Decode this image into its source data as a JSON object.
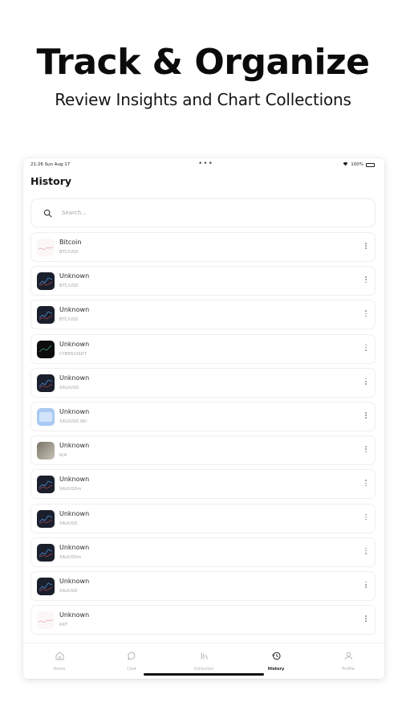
{
  "hero": {
    "title": "Track & Organize",
    "subtitle": "Review Insights and Chart Collections"
  },
  "status_bar": {
    "time": "21:26  Sun Aug 17",
    "dots": "•••",
    "battery": "100%",
    "icons": [
      "wifi-icon",
      "battery-icon"
    ]
  },
  "page": {
    "title": "History"
  },
  "search": {
    "placeholder": "Search...",
    "value": "",
    "icon": "search-icon"
  },
  "history_items": [
    {
      "title": "Bitcoin",
      "subtitle": "BTC/USD",
      "thumb": "light-chart"
    },
    {
      "title": "Unknown",
      "subtitle": "BTC/USD",
      "thumb": "dark-chart"
    },
    {
      "title": "Unknown",
      "subtitle": "BTC/USD",
      "thumb": "dark-chart"
    },
    {
      "title": "Unknown",
      "subtitle": "CYBER/USDT",
      "thumb": "black-chart"
    },
    {
      "title": "Unknown",
      "subtitle": "XAU/USD",
      "thumb": "dark-chart"
    },
    {
      "title": "Unknown",
      "subtitle": "XAU/USD.ND",
      "thumb": "blue-chart"
    },
    {
      "title": "Unknown",
      "subtitle": "N/A",
      "thumb": "photo"
    },
    {
      "title": "Unknown",
      "subtitle": "XAUUSDm",
      "thumb": "dark-chart"
    },
    {
      "title": "Unknown",
      "subtitle": "XAUUSD",
      "thumb": "dark-chart"
    },
    {
      "title": "Unknown",
      "subtitle": "XAUUSDm",
      "thumb": "dark-chart"
    },
    {
      "title": "Unknown",
      "subtitle": "XAUUSD",
      "thumb": "dark-chart"
    },
    {
      "title": "Unknown",
      "subtitle": "AXT",
      "thumb": "light-chart"
    }
  ],
  "tabs": [
    {
      "label": "Home",
      "icon": "home-icon",
      "active": false
    },
    {
      "label": "Chat",
      "icon": "chat-bubble-icon",
      "active": false
    },
    {
      "label": "Collection",
      "icon": "collection-bars-icon",
      "active": false
    },
    {
      "label": "History",
      "icon": "history-clock-icon",
      "active": true
    },
    {
      "label": "Profile",
      "icon": "user-icon",
      "active": false
    }
  ],
  "colors": {
    "background": "#ffffff",
    "text_primary": "#111111",
    "text_muted": "#a2a2a2",
    "border": "#efefef",
    "dark_thumb": "#1a1f2b"
  }
}
